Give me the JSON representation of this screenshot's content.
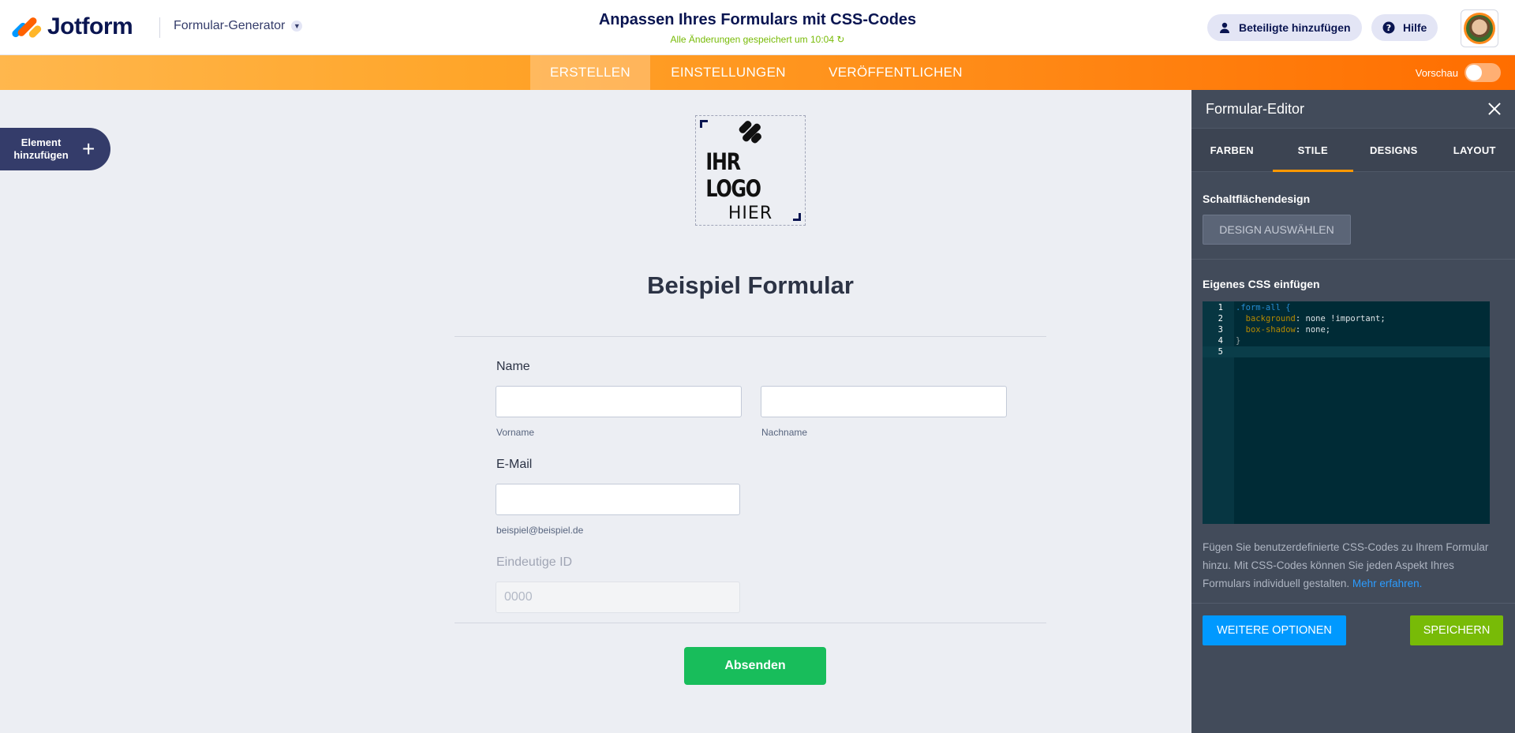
{
  "app": {
    "brand": "Jotform",
    "builder_menu": "Formular-Generator",
    "form_title": "Anpassen Ihres Formulars mit CSS-Codes",
    "saved_status": "Alle Änderungen gespeichert um 10:04",
    "invite_label": "Beteiligte hinzufügen",
    "help_label": "Hilfe"
  },
  "nav": {
    "tabs": [
      {
        "label": "ERSTELLEN",
        "active": true
      },
      {
        "label": "EINSTELLUNGEN",
        "active": false
      },
      {
        "label": "VERÖFFENTLICHEN",
        "active": false
      }
    ],
    "preview_label": "Vorschau",
    "preview_on": false
  },
  "add_element": {
    "label": "Element hinzufügen"
  },
  "form": {
    "logo_line1": "IHR LOGO",
    "logo_line2": "HIER",
    "heading": "Beispiel Formular",
    "name_label": "Name",
    "first_name_sub": "Vorname",
    "last_name_sub": "Nachname",
    "email_label": "E-Mail",
    "email_sub": "beispiel@beispiel.de",
    "unique_id_label": "Eindeutige ID",
    "unique_id_value": "0000",
    "submit_label": "Absenden"
  },
  "panel": {
    "title": "Formular-Editor",
    "tabs": [
      {
        "label": "FARBEN",
        "active": false
      },
      {
        "label": "STILE",
        "active": true
      },
      {
        "label": "DESIGNS",
        "active": false
      },
      {
        "label": "LAYOUT",
        "active": false
      }
    ],
    "button_design_title": "Schaltflächendesign",
    "design_button": "DESIGN AUSWÄHLEN",
    "custom_css_title": "Eigenes CSS einfügen",
    "code": {
      "line_numbers": [
        "1",
        "2",
        "3",
        "4",
        "5"
      ],
      "line1": ".form-all {",
      "line2_prop": "background",
      "line2_val": ": none !important;",
      "line3_prop": "box-shadow",
      "line3_val": ": none;",
      "line4": "}"
    },
    "help_text": "Fügen Sie benutzerdefinierte CSS-Codes zu Ihrem Formular hinzu. Mit CSS-Codes können Sie jeden Aspekt Ihres Formulars individuell gestalten.",
    "help_link": "Mehr erfahren.",
    "more_options": "WEITERE OPTIONEN",
    "save": "SPEICHERN"
  },
  "colors": {
    "brand_navy": "#0a1551",
    "orange_accent": "#ff6100",
    "submit_green": "#18bd5b",
    "save_green": "#78bb07",
    "link_blue": "#0099ff",
    "panel_bg": "#424b5a"
  }
}
